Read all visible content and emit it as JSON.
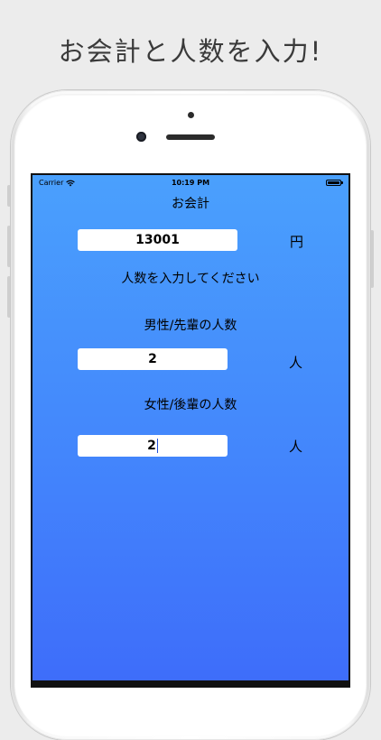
{
  "headline": "お会計と人数を入力!",
  "status_bar": {
    "carrier": "Carrier",
    "time": "10:19 PM"
  },
  "nav_title": "お会計",
  "total": {
    "value": "13001",
    "unit": "円"
  },
  "prompt": "人数を入力してください",
  "group_male": {
    "label": "男性/先輩の人数",
    "value": "2",
    "unit": "人"
  },
  "group_female": {
    "label": "女性/後輩の人数",
    "value": "2",
    "unit": "人"
  },
  "colors": {
    "screen_gradient_top": "#4aa0fd",
    "screen_gradient_bottom": "#3e6dfa",
    "cursor": "#1f4fd8"
  },
  "icons": [
    "wifi-icon",
    "battery-icon"
  ]
}
